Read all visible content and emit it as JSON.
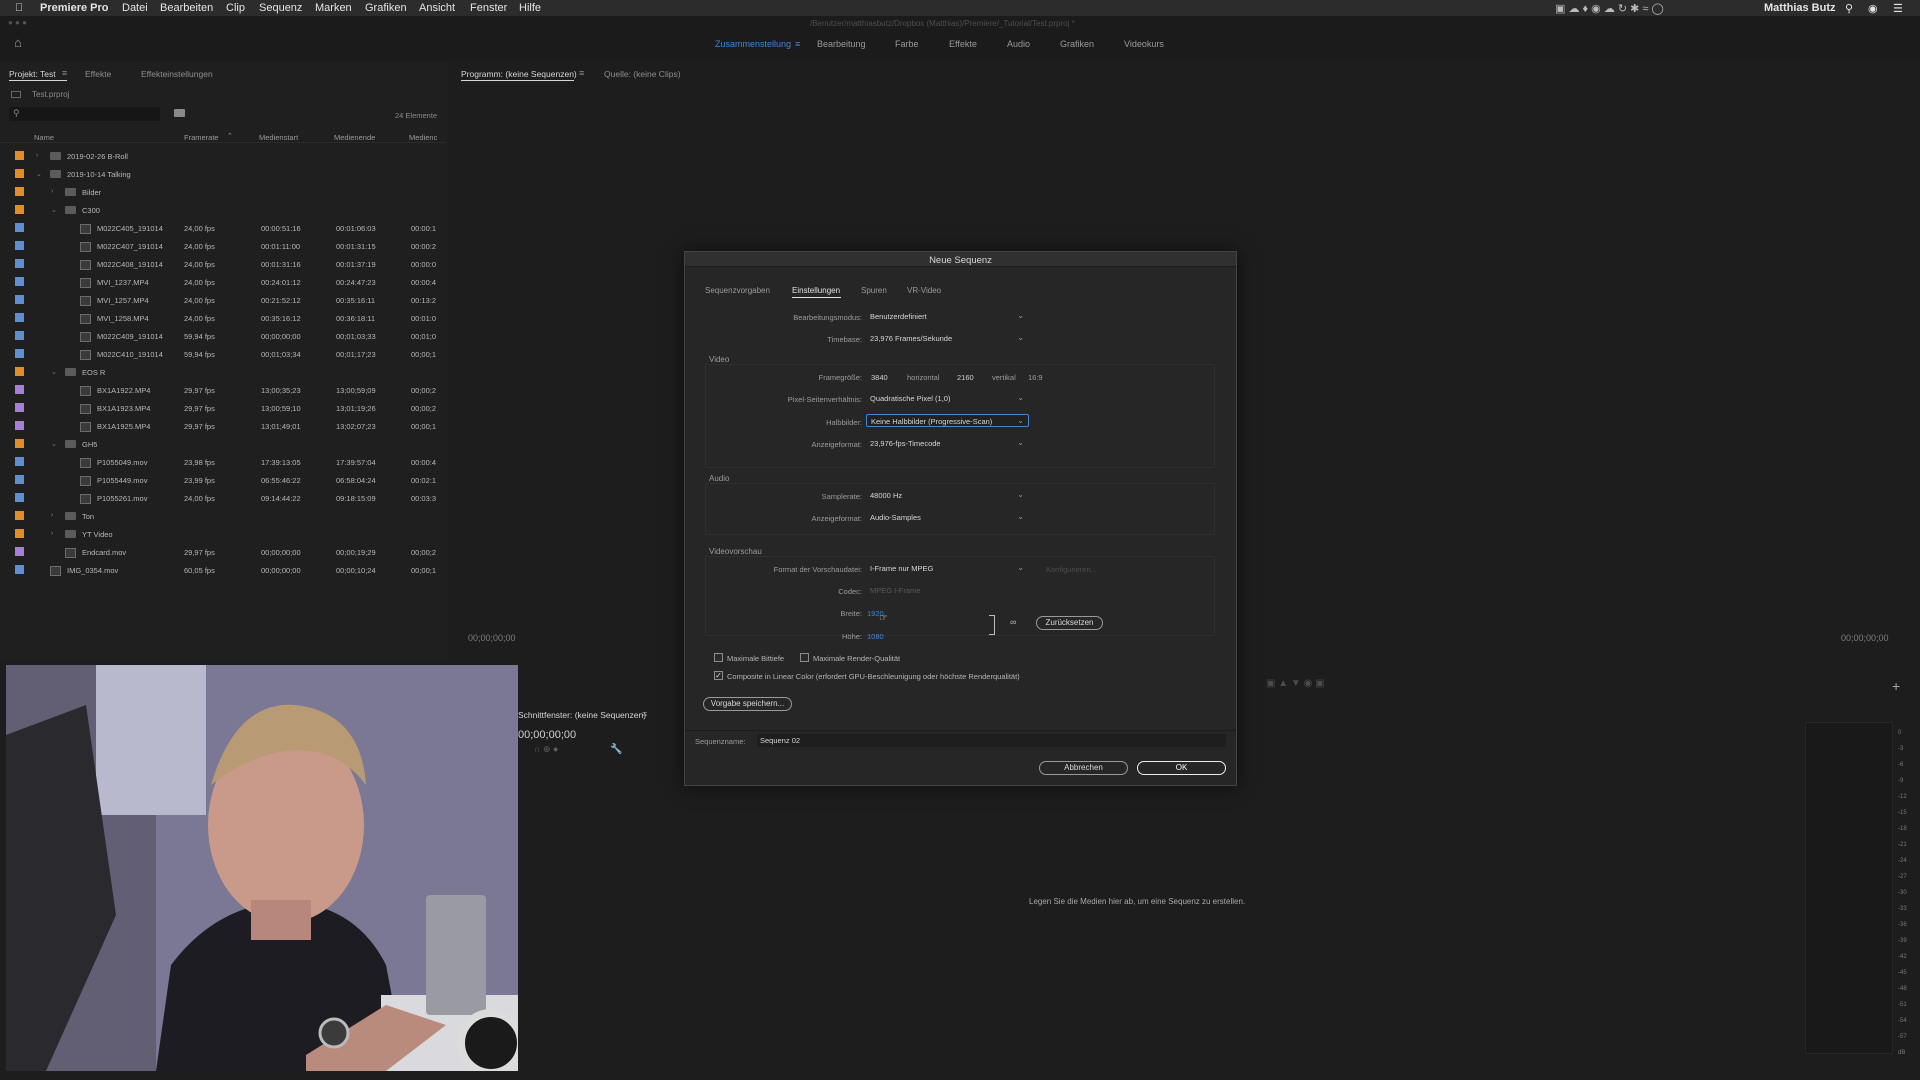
{
  "menubar": {
    "app": "Premiere Pro",
    "items": [
      "Datei",
      "Bearbeiten",
      "Clip",
      "Sequenz",
      "Marken",
      "Grafiken",
      "Ansicht",
      "Fenster",
      "Hilfe"
    ],
    "user": "Matthias Butz"
  },
  "window_path": "/Benutzer/matthiasbutz/Dropbox (Matthias)/Premiere/_Tutorial/Test.prproj *",
  "workspaces": [
    "Zusammenstellung",
    "Bearbeitung",
    "Farbe",
    "Effekte",
    "Audio",
    "Grafiken",
    "Videokurs"
  ],
  "workspace_active": "Zusammenstellung",
  "project_panel": {
    "tabs": [
      "Projekt: Test",
      "Effekte",
      "Effekteinstellungen"
    ],
    "file": "Test.prproj",
    "item_count": "24 Elemente",
    "columns": [
      "Name",
      "Framerate",
      "Medienstart",
      "Medienende",
      "Medienc"
    ],
    "rows": [
      {
        "name": "2019-02-26 B-Roll",
        "framerate": "",
        "start": "",
        "end": "",
        "dur": "",
        "type": "folder",
        "level": 1,
        "open": false,
        "color": "#e28d2c"
      },
      {
        "name": "2019-10-14 Talking",
        "framerate": "",
        "start": "",
        "end": "",
        "dur": "",
        "type": "folder",
        "level": 1,
        "open": true,
        "color": "#e28d2c"
      },
      {
        "name": "Bilder",
        "framerate": "",
        "start": "",
        "end": "",
        "dur": "",
        "type": "folder",
        "level": 2,
        "open": false,
        "color": "#e28d2c"
      },
      {
        "name": "C300",
        "framerate": "",
        "start": "",
        "end": "",
        "dur": "",
        "type": "folder",
        "level": 2,
        "open": true,
        "color": "#e28d2c"
      },
      {
        "name": "M022C405_191014",
        "framerate": "24,00 fps",
        "start": "00:00:51:16",
        "end": "00:01:06:03",
        "dur": "00:00:1",
        "type": "clip",
        "level": 3,
        "color": "#5f8ed1"
      },
      {
        "name": "M022C407_191014",
        "framerate": "24,00 fps",
        "start": "00:01:11:00",
        "end": "00:01:31:15",
        "dur": "00:00:2",
        "type": "clip",
        "level": 3,
        "color": "#5f8ed1"
      },
      {
        "name": "M022C408_191014",
        "framerate": "24,00 fps",
        "start": "00:01:31:16",
        "end": "00:01:37:19",
        "dur": "00:00:0",
        "type": "clip",
        "level": 3,
        "color": "#5f8ed1"
      },
      {
        "name": "MVI_1237.MP4",
        "framerate": "24,00 fps",
        "start": "00:24:01:12",
        "end": "00:24:47:23",
        "dur": "00:00:4",
        "type": "clip",
        "level": 3,
        "color": "#5f8ed1"
      },
      {
        "name": "MVI_1257.MP4",
        "framerate": "24,00 fps",
        "start": "00:21:52:12",
        "end": "00:35:16:11",
        "dur": "00:13:2",
        "type": "clip",
        "level": 3,
        "color": "#5f8ed1"
      },
      {
        "name": "MVI_1258.MP4",
        "framerate": "24,00 fps",
        "start": "00:35:16:12",
        "end": "00:36:18:11",
        "dur": "00:01:0",
        "type": "clip",
        "level": 3,
        "color": "#5f8ed1"
      },
      {
        "name": "M022C409_191014",
        "framerate": "59,94 fps",
        "start": "00;00;00;00",
        "end": "00;01;03;33",
        "dur": "00;01;0",
        "type": "clip",
        "level": 3,
        "color": "#5f8ed1"
      },
      {
        "name": "M022C410_191014",
        "framerate": "59,94 fps",
        "start": "00;01;03;34",
        "end": "00;01;17;23",
        "dur": "00;00;1",
        "type": "clip",
        "level": 3,
        "color": "#5f8ed1"
      },
      {
        "name": "EOS R",
        "framerate": "",
        "start": "",
        "end": "",
        "dur": "",
        "type": "folder",
        "level": 2,
        "open": true,
        "color": "#e28d2c"
      },
      {
        "name": "BX1A1922.MP4",
        "framerate": "29,97 fps",
        "start": "13;00;35;23",
        "end": "13;00;59;09",
        "dur": "00;00;2",
        "type": "clip",
        "level": 3,
        "color": "#a77fd6"
      },
      {
        "name": "BX1A1923.MP4",
        "framerate": "29,97 fps",
        "start": "13;00;59;10",
        "end": "13;01;19;26",
        "dur": "00;00;2",
        "type": "clip",
        "level": 3,
        "color": "#a77fd6"
      },
      {
        "name": "BX1A1925.MP4",
        "framerate": "29,97 fps",
        "start": "13;01;49;01",
        "end": "13;02;07;23",
        "dur": "00;00;1",
        "type": "clip",
        "level": 3,
        "color": "#a77fd6"
      },
      {
        "name": "GH5",
        "framerate": "",
        "start": "",
        "end": "",
        "dur": "",
        "type": "folder",
        "level": 2,
        "open": true,
        "color": "#e28d2c"
      },
      {
        "name": "P1055049.mov",
        "framerate": "23,98 fps",
        "start": "17:39:13:05",
        "end": "17:39:57:04",
        "dur": "00:00:4",
        "type": "clip",
        "level": 3,
        "color": "#5f8ed1"
      },
      {
        "name": "P1055449.mov",
        "framerate": "23,99 fps",
        "start": "06:55:46:22",
        "end": "06:58:04:24",
        "dur": "00:02:1",
        "type": "clip",
        "level": 3,
        "color": "#5f8ed1"
      },
      {
        "name": "P1055261.mov",
        "framerate": "24,00 fps",
        "start": "09:14:44:22",
        "end": "09:18:15:09",
        "dur": "00:03:3",
        "type": "clip",
        "level": 3,
        "color": "#5f8ed1"
      },
      {
        "name": "Ton",
        "framerate": "",
        "start": "",
        "end": "",
        "dur": "",
        "type": "folder",
        "level": 2,
        "open": false,
        "color": "#e28d2c"
      },
      {
        "name": "YT Video",
        "framerate": "",
        "start": "",
        "end": "",
        "dur": "",
        "type": "folder",
        "level": 2,
        "open": false,
        "color": "#e28d2c"
      },
      {
        "name": "Endcard.mov",
        "framerate": "29,97 fps",
        "start": "00;00;00;00",
        "end": "00;00;19;29",
        "dur": "00;00;2",
        "type": "clip",
        "level": 2,
        "color": "#a77fd6"
      },
      {
        "name": "IMG_0354.mov",
        "framerate": "60,05 fps",
        "start": "00;00;00;00",
        "end": "00;00;10;24",
        "dur": "00;00;1",
        "type": "clip",
        "level": 1,
        "color": "#5f8ed1"
      }
    ]
  },
  "program_panel": {
    "tabs": [
      "Programm: (keine Sequenzen)",
      "Quelle: (keine Clips)"
    ],
    "timecode_left": "00;00;00;00",
    "timecode_right": "00;00;00;00"
  },
  "timeline_panel": {
    "tab": "Schnittfenster: (keine Sequenzen)",
    "timecode": "00;00;00;00",
    "drop_hint": "Legen Sie die Medien hier ab, um eine Sequenz zu erstellen."
  },
  "meter": {
    "ticks": [
      "0",
      "-3",
      "-6",
      "-9",
      "-12",
      "-15",
      "-18",
      "-21",
      "-24",
      "-27",
      "-30",
      "-33",
      "-36",
      "-39",
      "-42",
      "-45",
      "-48",
      "-51",
      "-54",
      "-57",
      "dB"
    ]
  },
  "dialog": {
    "title": "Neue Sequenz",
    "tabs": [
      "Sequenzvorgaben",
      "Einstellungen",
      "Spuren",
      "VR-Video"
    ],
    "active_tab": "Einstellungen",
    "bearbeitungsmodus_label": "Bearbeitungsmodus:",
    "bearbeitungsmodus": "Benutzerdefiniert",
    "timebase_label": "Timebase:",
    "timebase": "23,976  Frames/Sekunde",
    "video_section": "Video",
    "framegroesse_label": "Framegröße:",
    "frame_w": "3840",
    "horizontal_label": "horizontal",
    "frame_h": "2160",
    "vertikal_label": "vertikal",
    "aspect": "16:9",
    "pixel_label": "Pixel-Seitenverhältnis:",
    "pixel": "Quadratische Pixel (1,0)",
    "halbbilder_label": "Halbbilder:",
    "halbbilder": "Keine Halbbilder (Progressive-Scan)",
    "anzeigeformat_label": "Anzeigeformat:",
    "anzeigeformat_video": "23,976-fps-Timecode",
    "audio_section": "Audio",
    "samplerate_label": "Samplerate:",
    "samplerate": "48000 Hz",
    "anzeigeformat_audio": "Audio-Samples",
    "preview_section": "Videovorschau",
    "vorschau_label": "Format der Vorschaudatei:",
    "vorschau": "I-Frame nur MPEG",
    "konfigurieren": "Konfigurieren...",
    "codec_label": "Codec:",
    "codec": "MPEG I-Frame",
    "breite_label": "Breite:",
    "breite": "1920",
    "hoehe_label": "Höhe:",
    "hoehe": "1080",
    "reset_button": "Zurücksetzen",
    "max_bittiefe": "Maximale Bittiefe",
    "max_render": "Maximale Render-Qualität",
    "composite": "Composite in Linear Color (erfordert GPU-Beschleunigung oder höchste Renderqualität)",
    "save_preset": "Vorgabe speichern...",
    "sequenzname_label": "Sequenzname:",
    "sequenzname": "Sequenz 02",
    "cancel": "Abbrechen",
    "ok": "OK"
  },
  "colors": {
    "accent": "#3f87d6",
    "label_orange": "#e28d2c",
    "label_blue": "#5f8ed1",
    "label_violet": "#a77fd6"
  }
}
